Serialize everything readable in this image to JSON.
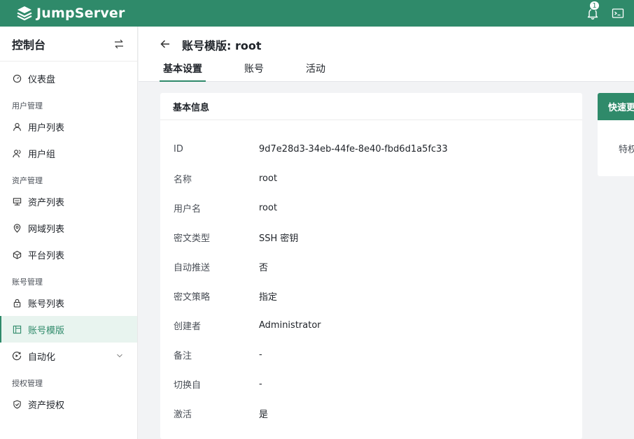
{
  "header": {
    "brand": "JumpServer",
    "notification_count": "1"
  },
  "sidebar": {
    "title": "控制台",
    "items": [
      {
        "type": "item",
        "label": "仪表盘",
        "icon": "dashboard-icon"
      },
      {
        "type": "group",
        "label": "用户管理"
      },
      {
        "type": "item",
        "label": "用户列表",
        "icon": "user-icon"
      },
      {
        "type": "item",
        "label": "用户组",
        "icon": "users-icon"
      },
      {
        "type": "group",
        "label": "资产管理"
      },
      {
        "type": "item",
        "label": "资产列表",
        "icon": "server-icon"
      },
      {
        "type": "item",
        "label": "网域列表",
        "icon": "location-icon"
      },
      {
        "type": "item",
        "label": "平台列表",
        "icon": "cube-icon"
      },
      {
        "type": "group",
        "label": "账号管理"
      },
      {
        "type": "item",
        "label": "账号列表",
        "icon": "lock-icon"
      },
      {
        "type": "item",
        "label": "账号模版",
        "icon": "template-icon",
        "active": true
      },
      {
        "type": "item",
        "label": "自动化",
        "icon": "automation-icon",
        "expandable": true
      },
      {
        "type": "group",
        "label": "授权管理"
      },
      {
        "type": "item",
        "label": "资产授权",
        "icon": "shield-icon"
      }
    ]
  },
  "page": {
    "title": "账号模版: root",
    "tabs": [
      {
        "label": "基本设置",
        "active": true
      },
      {
        "label": "账号",
        "active": false
      },
      {
        "label": "活动",
        "active": false
      }
    ]
  },
  "info_card": {
    "title": "基本信息",
    "rows": [
      {
        "key": "ID",
        "value": "9d7e28d3-34eb-44fe-8e40-fbd6d1a5fc33"
      },
      {
        "key": "名称",
        "value": "root"
      },
      {
        "key": "用户名",
        "value": "root"
      },
      {
        "key": "密文类型",
        "value": "SSH 密钥"
      },
      {
        "key": "自动推送",
        "value": "否"
      },
      {
        "key": "密文策略",
        "value": "指定"
      },
      {
        "key": "创建者",
        "value": "Administrator"
      },
      {
        "key": "备注",
        "value": "-"
      },
      {
        "key": "切换自",
        "value": "-"
      },
      {
        "key": "激活",
        "value": "是"
      }
    ]
  },
  "quick_card": {
    "title": "快速更新",
    "first_item": "特权账号"
  },
  "colors": {
    "brand": "#2f8a6a",
    "active_bg": "#e8f4ef",
    "page_bg": "#f2f3f5"
  }
}
